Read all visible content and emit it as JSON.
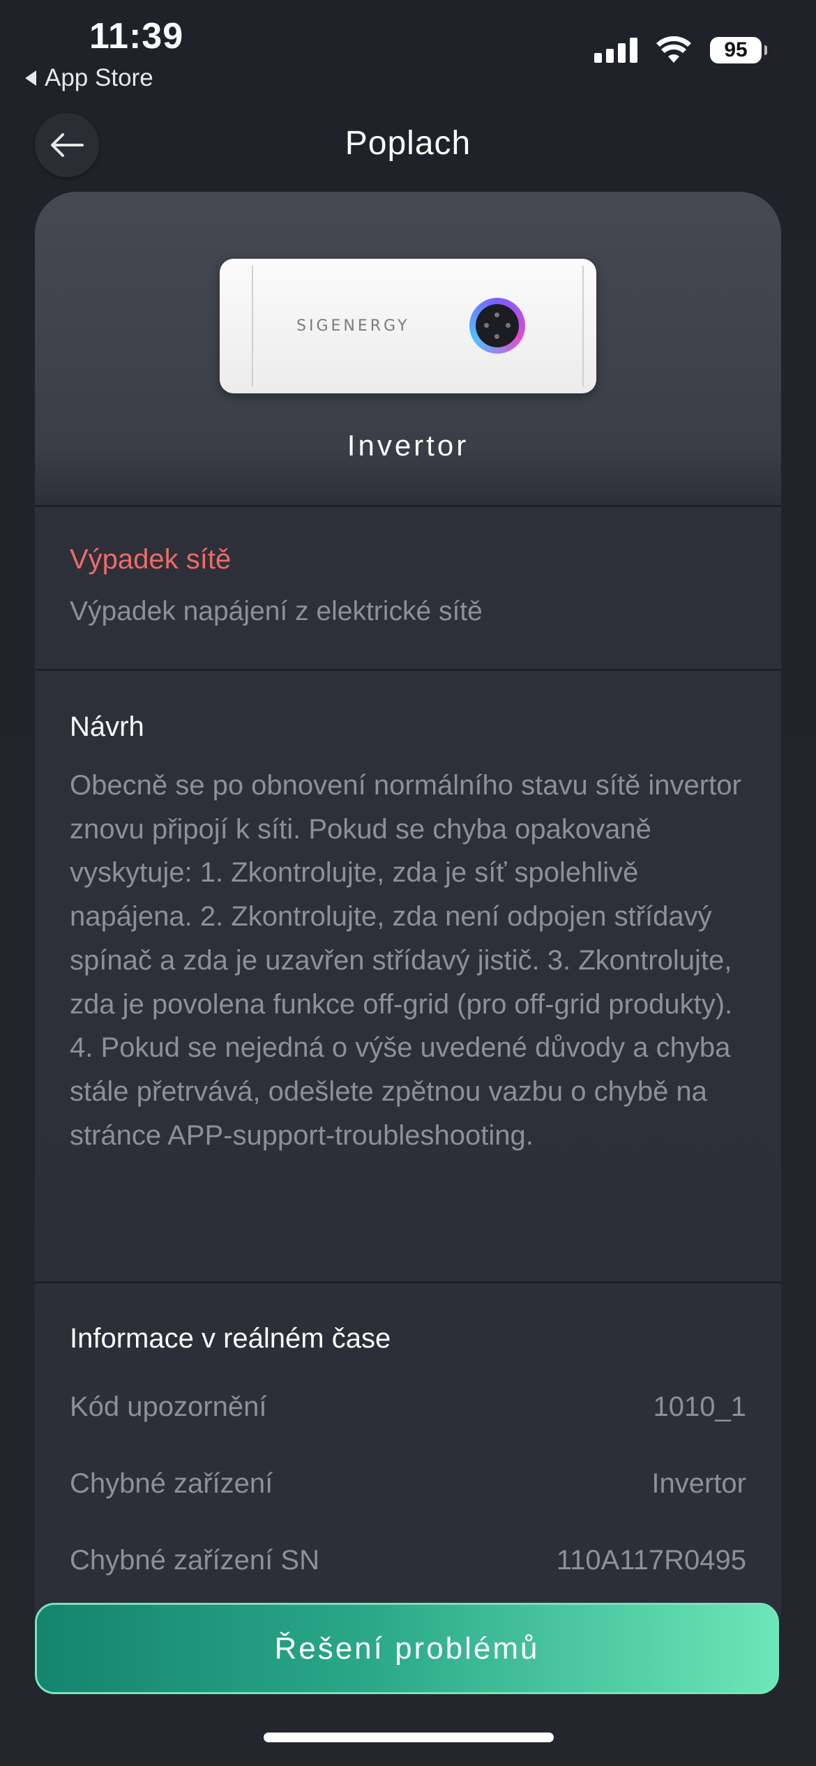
{
  "status_bar": {
    "time": "11:39",
    "back_app": "App Store",
    "battery": "95"
  },
  "header": {
    "title": "Poplach",
    "back_icon": "arrow-left-icon"
  },
  "device": {
    "brand_text": "SIGENERGY",
    "name": "Invertor"
  },
  "alert": {
    "title": "Výpadek sítě",
    "description": "Výpadek napájení z elektrické sítě",
    "title_color": "#ef6a68"
  },
  "suggestion": {
    "title": "Návrh",
    "text": "Obecně se po obnovení normálního stavu sítě invertor znovu připojí k síti. Pokud se chyba opakovaně vyskytuje: 1. Zkontrolujte, zda je síť spolehlivě napájena. 2. Zkontrolujte, zda není odpojen střídavý spínač a zda je uzavřen střídavý jistič. 3. Zkontrolujte, zda je povolena funkce off-grid (pro off-grid produkty). 4. Pokud se nejedná o výše uvedené důvody a chyba stále přetrvává, odešlete zpětnou vazbu o chybě na stránce APP-support-troubleshooting."
  },
  "realtime": {
    "title": "Informace v reálném čase",
    "rows": [
      {
        "label": "Kód upozornění",
        "value": "1010_1"
      },
      {
        "label": "Chybné zařízení",
        "value": "Invertor"
      },
      {
        "label": "Chybné zařízení SN",
        "value": "110A117R0495"
      }
    ]
  },
  "cta": {
    "label": "Řešení problémů",
    "color": "#2aa888"
  }
}
